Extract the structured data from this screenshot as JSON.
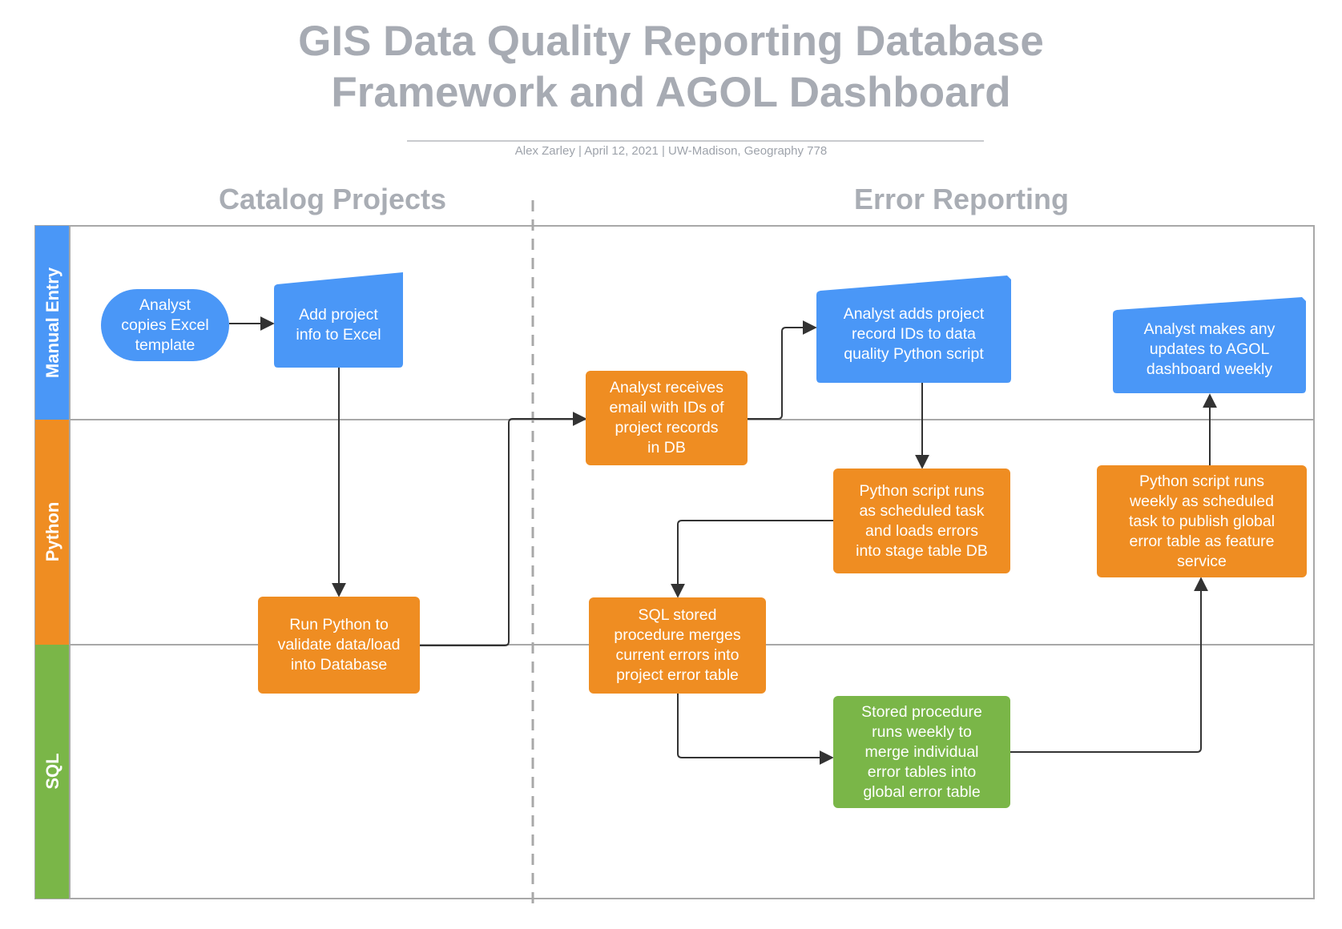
{
  "title_line1": "GIS Data Quality Reporting Database",
  "title_line2": "Framework and AGOL Dashboard",
  "subtitle": "Alex Zarley  |  April 12, 2021  |  UW-Madison, Geography 778",
  "phases": {
    "left": "Catalog Projects",
    "right": "Error Reporting"
  },
  "lanes": {
    "manual": "Manual Entry",
    "python": "Python",
    "sql": "SQL"
  },
  "colors": {
    "blue": "#4a97f7",
    "orange": "#ef8d22",
    "green": "#7ab648",
    "lane_border": "#a8a8a8"
  },
  "nodes": {
    "copy_template": "Analyst\ncopies Excel\ntemplate",
    "add_info": "Add project\ninfo to Excel",
    "run_python": "Run Python to\nvalidate data/load\ninto Database",
    "receive_email": "Analyst receives\nemail with IDs of\nproject records\nin DB",
    "add_ids": "Analyst adds project\nrecord IDs to data\nquality Python script",
    "scheduled_task": "Python script runs\nas scheduled task\nand loads errors\ninto stage table DB",
    "sql_merge": "SQL stored\nprocedure merges\ncurrent errors into\nproject error table",
    "weekly_merge": "Stored procedure\nruns weekly to\nmerge individual\nerror tables into\nglobal error table",
    "publish": "Python script runs\nweekly as scheduled\ntask to publish global\nerror table as feature\nservice",
    "agol_update": "Analyst makes any\nupdates to AGOL\ndashboard weekly"
  }
}
